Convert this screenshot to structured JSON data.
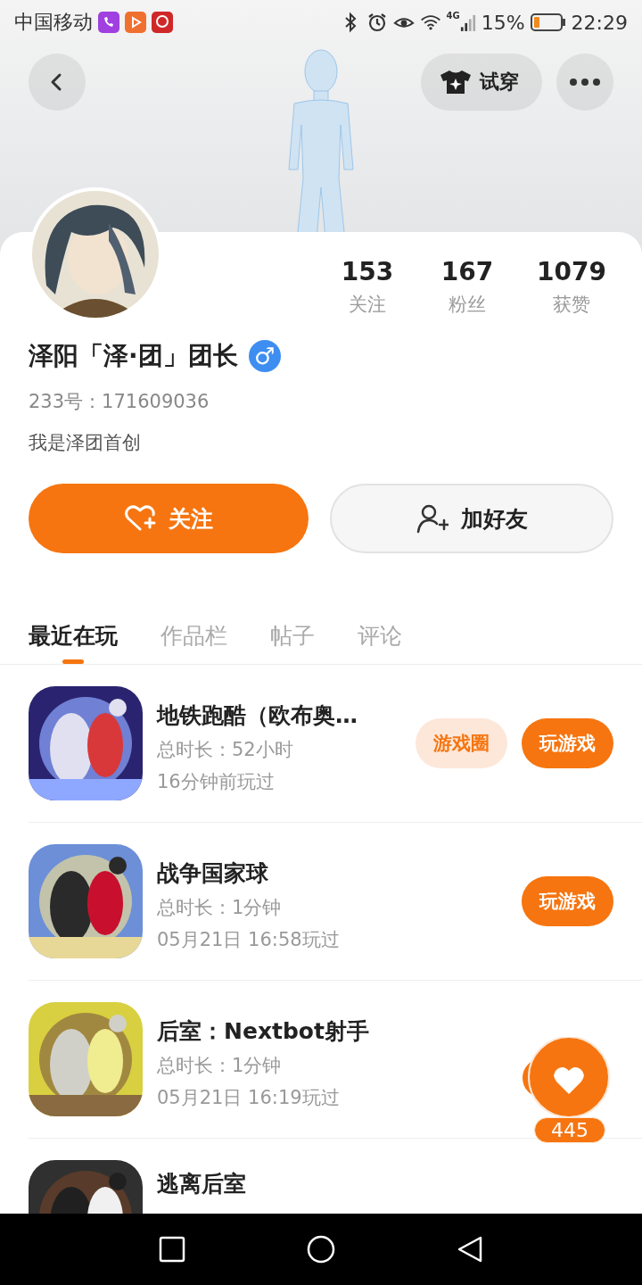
{
  "status_bar": {
    "carrier": "中国移动",
    "network": "4G",
    "battery_text": "15%",
    "time": "22:29"
  },
  "header": {
    "try_on_button": "试穿"
  },
  "profile": {
    "stats": [
      {
        "value": "153",
        "label": "关注"
      },
      {
        "value": "167",
        "label": "粉丝"
      },
      {
        "value": "1079",
        "label": "获赞"
      }
    ],
    "name": "泽阳「泽·团」团长",
    "gender": "♂",
    "id": "233号：171609036",
    "bio": "我是泽团首创"
  },
  "actions": [
    {
      "label": "关注",
      "kind": "follow"
    },
    {
      "label": "加好友",
      "kind": "add_friend"
    }
  ],
  "tabs": [
    {
      "label": "最近在玩",
      "selected": true
    },
    {
      "label": "作品栏",
      "selected": false
    },
    {
      "label": "帖子",
      "selected": false
    },
    {
      "label": "评论",
      "selected": false
    }
  ],
  "games": [
    {
      "title": "地铁跑酷（欧布奥…",
      "playtime": "总时长：52小时",
      "last_played": "16分钟前玩过",
      "buttons": [
        {
          "label": "游戏圈",
          "kind": "circle"
        },
        {
          "label": "玩游戏",
          "kind": "play"
        }
      ]
    },
    {
      "title": "战争国家球",
      "playtime": "总时长：1分钟",
      "last_played": "05月21日 16:58玩过",
      "buttons": [
        {
          "label": "玩游戏",
          "kind": "play"
        }
      ]
    },
    {
      "title": "后室：Nextbot射手",
      "playtime": "总时长：1分钟",
      "last_played": "05月21日 16:19玩过"
    },
    {
      "title": "逃离后室"
    }
  ],
  "like_widget": {
    "count": "445"
  }
}
